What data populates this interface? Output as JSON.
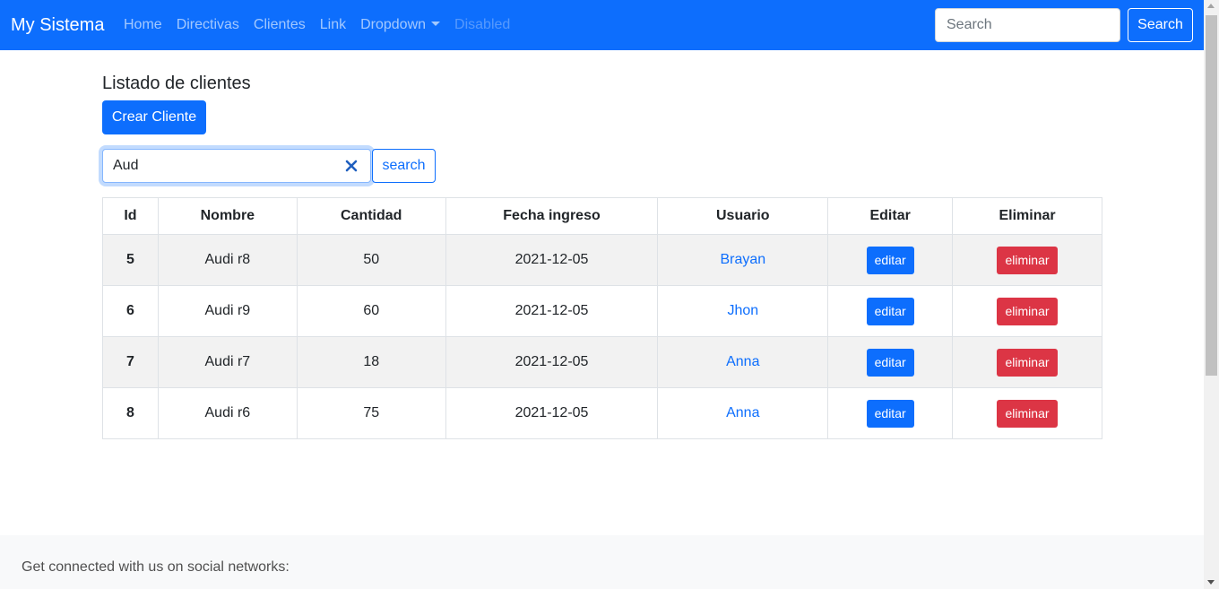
{
  "navbar": {
    "brand": "My Sistema",
    "links": [
      "Home",
      "Directivas",
      "Clientes",
      "Link"
    ],
    "dropdown_label": "Dropdown",
    "disabled_label": "Disabled",
    "search_placeholder": "Search",
    "search_button": "Search"
  },
  "page": {
    "title": "Listado de clientes",
    "create_button": "Crear Cliente",
    "filter_value": "Aud",
    "filter_button": "search"
  },
  "table": {
    "headers": [
      "Id",
      "Nombre",
      "Cantidad",
      "Fecha ingreso",
      "Usuario",
      "Editar",
      "Eliminar"
    ],
    "rows": [
      {
        "id": "5",
        "nombre": "Audi r8",
        "cantidad": "50",
        "fecha": "2021-12-05",
        "usuario": "Brayan",
        "editar": "editar",
        "eliminar": "eliminar"
      },
      {
        "id": "6",
        "nombre": "Audi r9",
        "cantidad": "60",
        "fecha": "2021-12-05",
        "usuario": "Jhon",
        "editar": "editar",
        "eliminar": "eliminar"
      },
      {
        "id": "7",
        "nombre": "Audi r7",
        "cantidad": "18",
        "fecha": "2021-12-05",
        "usuario": "Anna",
        "editar": "editar",
        "eliminar": "eliminar"
      },
      {
        "id": "8",
        "nombre": "Audi r6",
        "cantidad": "75",
        "fecha": "2021-12-05",
        "usuario": "Anna",
        "editar": "editar",
        "eliminar": "eliminar"
      }
    ]
  },
  "footer": {
    "text": "Get connected with us on social networks:"
  },
  "colors": {
    "primary": "#0d6efd",
    "danger": "#dc3545",
    "stripe": "#f2f2f2",
    "footer_bg": "#f8f9fa"
  },
  "icons": {
    "clear": "close-icon",
    "dropdown": "caret-down-icon"
  }
}
